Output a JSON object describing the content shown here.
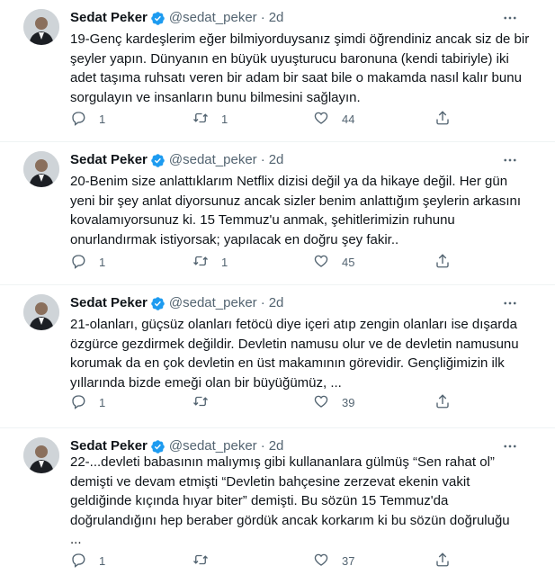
{
  "tweets": [
    {
      "name": "Sedat Peker",
      "handle": "@sedat_peker",
      "time": "2d",
      "text": "19-Genç kardeşlerim eğer bilmiyorduysanız şimdi öğrendiniz ancak siz de bir\nşeyler yapın.  Dünyanın en büyük uyuşturucu baronuna (kendi tabiriyle) iki\nadet taşıma ruhsatı veren bir adam bir saat bile o makamda nasıl kalır bunu\nsorgulayın ve insanların bunu bilmesini sağlayın.",
      "replies": "1",
      "retweets": "1",
      "likes": "44"
    },
    {
      "name": "Sedat Peker",
      "handle": "@sedat_peker",
      "time": "2d",
      "text": "20-Benim size anlattıklarım Netflix dizisi değil ya da hikaye değil. Her gün\nyeni bir şey anlat diyorsunuz ancak sizler benim anlattığım şeylerin arkasını\nkovalamıyorsunuz ki. 15 Temmuz'u anmak, şehitlerimizin ruhunu\nonurlandırmak istiyorsak; yapılacak en doğru şey fakir..",
      "replies": "1",
      "retweets": "1",
      "likes": "45"
    },
    {
      "name": "Sedat Peker",
      "handle": "@sedat_peker",
      "time": "2d",
      "text": "21-olanları, güçsüz olanları fetöcü diye içeri atıp zengin olanları ise dışarda\nözgürce gezdirmek değildir. Devletin namusu olur ve de devletin namusunu\nkorumak da en çok devletin en üst makamının görevidir. Gençliğimizin ilk\nyıllarında bizde emeği olan bir büyüğümüz, ...",
      "replies": "1",
      "retweets": "",
      "likes": "39"
    },
    {
      "name": "Sedat Peker",
      "handle": "@sedat_peker",
      "time": "2d",
      "text": "22-...devleti babasının malıymış gibi kullananlara gülmüş “Sen rahat ol”\ndemişti ve devam etmişti  “Devletin bahçesine zerzevat ekenin vakit\ngeldiğinde kıçında hıyar biter” demişti.  Bu sözün 15 Temmuz'da\ndoğrulandığını hep beraber gördük ancak korkarım ki bu sözün doğruluğu\n...",
      "replies": "1",
      "retweets": "",
      "likes": "37"
    }
  ],
  "icons": {
    "verified": "verified-badge-icon",
    "more": "more-options-icon",
    "reply": "reply-icon",
    "retweet": "retweet-icon",
    "like": "like-icon",
    "share": "share-icon"
  },
  "colors": {
    "verified": "#1d9bf0",
    "text": "#0f1419",
    "muted": "#536471",
    "divider": "#eff3f4"
  }
}
